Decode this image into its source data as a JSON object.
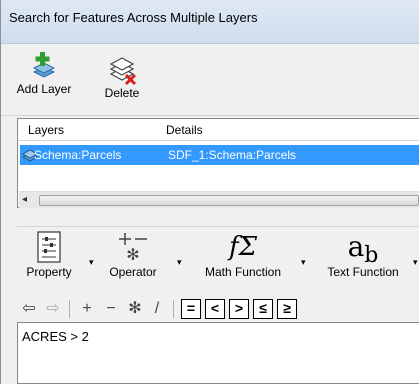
{
  "window": {
    "title": "Search for Features Across Multiple Layers"
  },
  "toolbar": {
    "add_layer_label": "Add Layer",
    "delete_label": "Delete"
  },
  "layers_list": {
    "columns": [
      "Layers",
      "Details"
    ],
    "rows": [
      {
        "layer": "Schema:Parcels",
        "details": "SDF_1:Schema:Parcels",
        "selected": true
      }
    ],
    "scroll_left_arrow": "◂"
  },
  "expression_toolbar": {
    "property_label": "Property",
    "operator_label": "Operator",
    "math_function_label": "Math Function",
    "text_function_label": "Text Function",
    "dropdown_glyph": "▾",
    "math_glyph": "fΣ",
    "text_glyph_a": "a",
    "text_glyph_b": "b"
  },
  "operator_bar": {
    "undo": "⇦",
    "redo": "⇨",
    "plus": "+",
    "minus": "−",
    "multiply": "✻",
    "divide": "/",
    "equals": "=",
    "less_than": "<",
    "greater_than": ">",
    "less_equal": "≤",
    "greater_equal": "≥"
  },
  "editor": {
    "expression": "ACRES  > 2"
  },
  "colors": {
    "selection": "#3399ff",
    "titlebar": "#cfdcec",
    "add_icon_green": "#2e9e2e",
    "delete_icon_red": "#d62020"
  },
  "icons": {
    "add_layer": "add-layer-icon",
    "delete": "delete-layer-icon",
    "layer": "layer-stack-icon",
    "property": "property-icon",
    "operator": "operator-icon"
  }
}
